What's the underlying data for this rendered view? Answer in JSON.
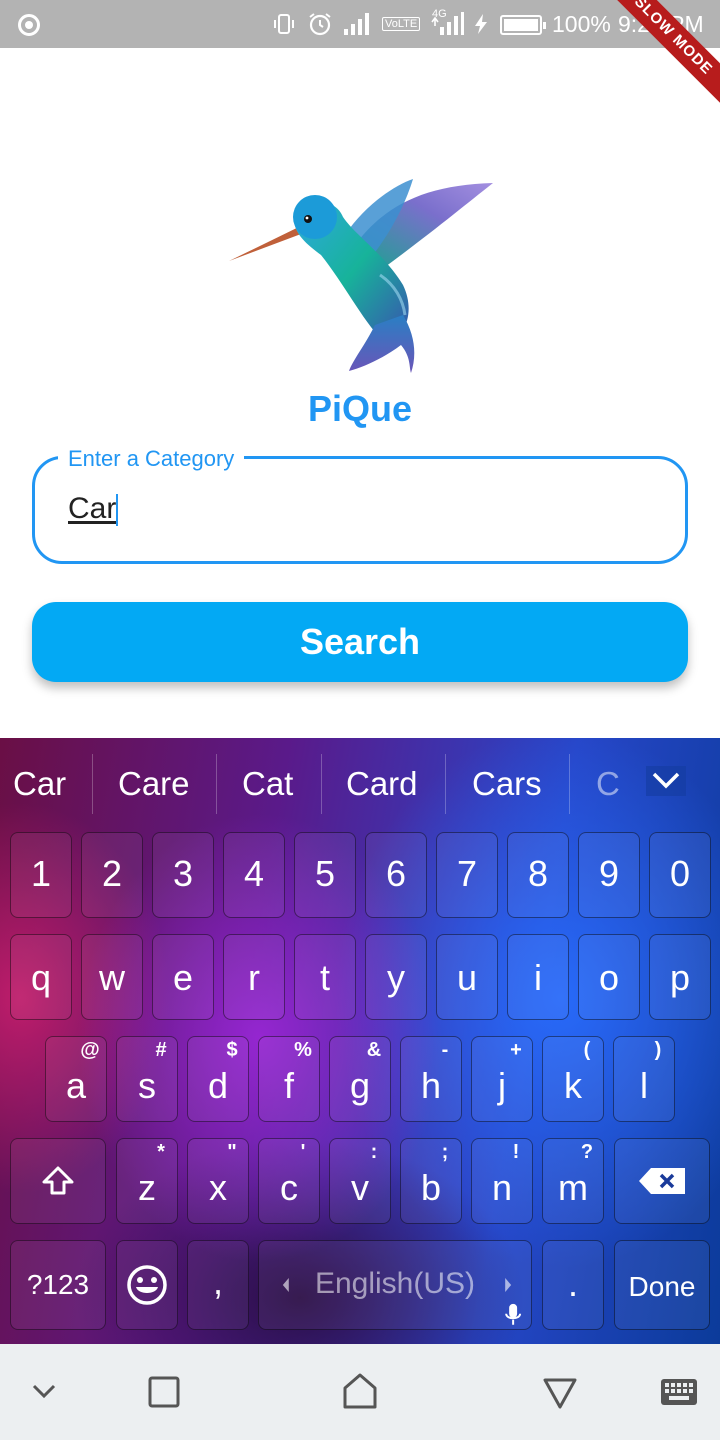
{
  "status_bar": {
    "battery_percent": "100%",
    "time": "9:21 PM",
    "network": "4G",
    "volte": "VoLTE",
    "ribbon": "SLOW MODE"
  },
  "app": {
    "title": "PiQue",
    "logo": "hummingbird-icon",
    "search_field": {
      "label": "Enter a Category",
      "value": "Car"
    },
    "search_button": "Search"
  },
  "keyboard": {
    "suggestions": [
      "Car",
      "Care",
      "Cat",
      "Card",
      "Cars",
      "C"
    ],
    "number_row": [
      "1",
      "2",
      "3",
      "4",
      "5",
      "6",
      "7",
      "8",
      "9",
      "0"
    ],
    "row1": [
      "q",
      "w",
      "e",
      "r",
      "t",
      "y",
      "u",
      "i",
      "o",
      "p"
    ],
    "row2": [
      {
        "key": "a",
        "alt": "@"
      },
      {
        "key": "s",
        "alt": "#"
      },
      {
        "key": "d",
        "alt": "$"
      },
      {
        "key": "f",
        "alt": "%"
      },
      {
        "key": "g",
        "alt": "&"
      },
      {
        "key": "h",
        "alt": "-"
      },
      {
        "key": "j",
        "alt": "+"
      },
      {
        "key": "k",
        "alt": "("
      },
      {
        "key": "l",
        "alt": ")"
      }
    ],
    "row3": [
      {
        "key": "z",
        "alt": "*"
      },
      {
        "key": "x",
        "alt": "\""
      },
      {
        "key": "c",
        "alt": "'"
      },
      {
        "key": "v",
        "alt": ":"
      },
      {
        "key": "b",
        "alt": ";"
      },
      {
        "key": "n",
        "alt": "!"
      },
      {
        "key": "m",
        "alt": "?"
      }
    ],
    "bottom": {
      "symbols": "?123",
      "comma": ",",
      "space": "English(US)",
      "period": ".",
      "done": "Done"
    }
  }
}
